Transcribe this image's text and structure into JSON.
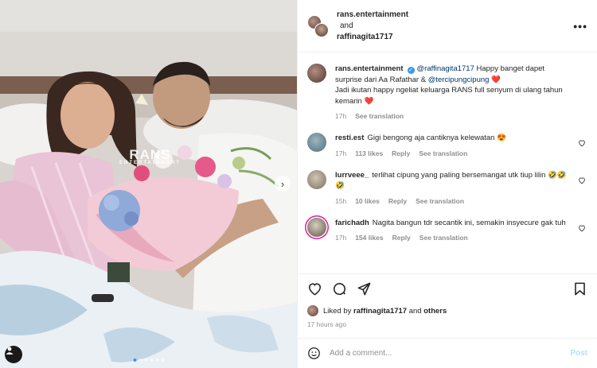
{
  "photo": {
    "watermark_main": "RANS",
    "watermark_sub": "ENTERTAINMENT",
    "next_icon": "chevron-right-icon",
    "user_tag_icon": "person-icon",
    "carousel_count": 6,
    "carousel_active_index": 0
  },
  "header": {
    "user1": "rans.entertainment",
    "joiner": "and",
    "user2": "raffinagita1717",
    "more_icon": "more-horizontal-icon",
    "more_label": "•••"
  },
  "caption": {
    "user": "rans.entertainment",
    "mention1": "@raffinagita1717",
    "text1": " Happy banget dapet surprise dari Aa Rafathar & ",
    "mention2": "@tercipungcipung",
    "heart1": "❤️",
    "text2": "Jadi ikutan happy ngeliat keluarga RANS full senyum di ulang tahun kemarin ",
    "heart2": "❤️",
    "time": "17h",
    "see_translation": "See translation"
  },
  "comments": [
    {
      "user": "resti.est",
      "text": "Gigi bengong aja cantiknya kelewatan 😍",
      "time": "17h",
      "likes": "113 likes",
      "reply": "Reply",
      "see_translation": "See translation",
      "avatar_color": "#6b8f9c"
    },
    {
      "user": "lurrveee_",
      "text": "terlihat cipung yang paling bersemangat utk tiup lilin 🤣🤣🤣",
      "time": "15h",
      "likes": "10 likes",
      "reply": "Reply",
      "see_translation": "See translation",
      "avatar_color": "#a39a86"
    },
    {
      "user": "farichadh",
      "text": "Nagita bangun tdr secantik ini, semakin insyecure gak tuh",
      "time": "17h",
      "likes": "154 likes",
      "reply": "Reply",
      "see_translation": "See translation",
      "avatar_color": "#8b7a63"
    }
  ],
  "actions": {
    "like_icon": "heart-icon",
    "comment_icon": "comment-icon",
    "share_icon": "share-icon",
    "save_icon": "bookmark-icon"
  },
  "likes": {
    "prefix": "Liked by ",
    "user": "raffinagita1717",
    "mid": " and ",
    "others": "others"
  },
  "time_ago": "17 hours ago",
  "add_comment": {
    "emoji_icon": "emoji-icon",
    "placeholder": "Add a comment...",
    "post_label": "Post"
  },
  "colors": {
    "link": "#00376b",
    "verified": "#3897f0",
    "heart": "#ed4956",
    "muted": "#8e8e8e",
    "post_disabled": "#b2dffc"
  }
}
